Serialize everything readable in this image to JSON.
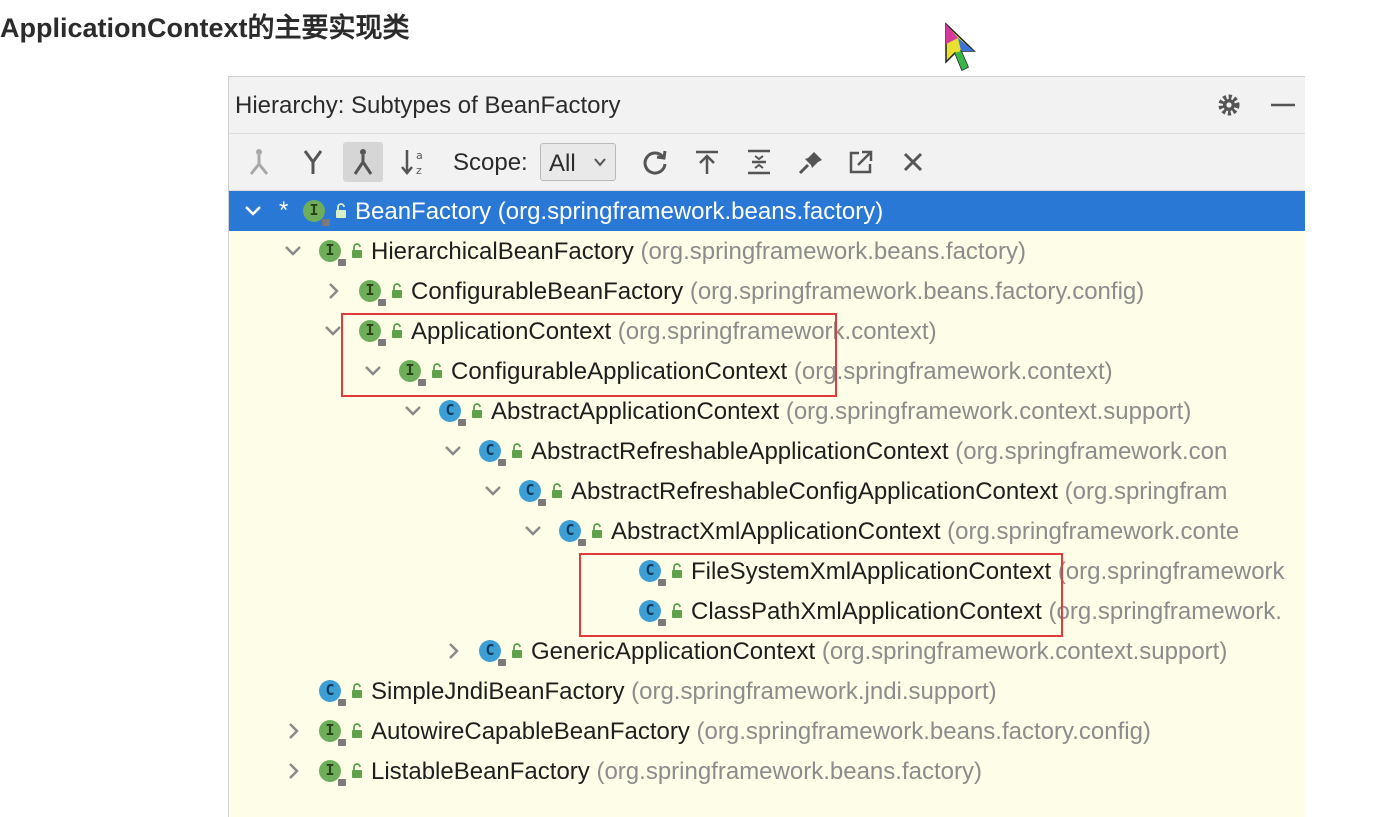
{
  "page": {
    "title": "ApplicationContext的主要实现类"
  },
  "panel": {
    "title": "Hierarchy:  Subtypes of BeanFactory",
    "header_icons": [
      "gear-icon",
      "minimize-icon"
    ]
  },
  "toolbar": {
    "buttons": [
      "supertypes-hierarchy-icon",
      "subtypes-hierarchy-icon",
      "class-hierarchy-icon",
      "sort-alphabetically-icon",
      "refresh-icon",
      "export-icon",
      "expand-all-icon",
      "pin-icon",
      "open-in-window-icon",
      "close-icon"
    ],
    "scope_label": "Scope:",
    "scope_value": "All"
  },
  "tree": {
    "rows": [
      {
        "name": "BeanFactory",
        "pkg": "(org.springframework.beans.factory)",
        "kind": "I",
        "arrow": "expanded",
        "selected": true,
        "star": "*"
      },
      {
        "name": "HierarchicalBeanFactory",
        "pkg": "(org.springframework.beans.factory)",
        "kind": "I",
        "arrow": "expanded"
      },
      {
        "name": "ConfigurableBeanFactory",
        "pkg": "(org.springframework.beans.factory.config)",
        "kind": "I",
        "arrow": "collapsed"
      },
      {
        "name": "ApplicationContext",
        "pkg": "(org.springframework.context)",
        "kind": "I",
        "arrow": "expanded"
      },
      {
        "name": "ConfigurableApplicationContext",
        "pkg": "(org.springframework.context)",
        "kind": "I",
        "arrow": "expanded"
      },
      {
        "name": "AbstractApplicationContext",
        "pkg": "(org.springframework.context.support)",
        "kind": "C",
        "arrow": "expanded"
      },
      {
        "name": "AbstractRefreshableApplicationContext",
        "pkg": "(org.springframework.con",
        "kind": "C",
        "arrow": "expanded"
      },
      {
        "name": "AbstractRefreshableConfigApplicationContext",
        "pkg": "(org.springfram",
        "kind": "C",
        "arrow": "expanded"
      },
      {
        "name": "AbstractXmlApplicationContext",
        "pkg": "(org.springframework.conte",
        "kind": "C",
        "arrow": "expanded"
      },
      {
        "name": "FileSystemXmlApplicationContext",
        "pkg": "(org.springframework",
        "kind": "C",
        "arrow": "none"
      },
      {
        "name": "ClassPathXmlApplicationContext",
        "pkg": "(org.springframework.",
        "kind": "C",
        "arrow": "none"
      },
      {
        "name": "GenericApplicationContext",
        "pkg": "(org.springframework.context.support)",
        "kind": "C",
        "arrow": "collapsed"
      },
      {
        "name": "SimpleJndiBeanFactory",
        "pkg": "(org.springframework.jndi.support)",
        "kind": "C",
        "arrow": "none"
      },
      {
        "name": "AutowireCapableBeanFactory",
        "pkg": "(org.springframework.beans.factory.config)",
        "kind": "I",
        "arrow": "collapsed"
      },
      {
        "name": "ListableBeanFactory",
        "pkg": "(org.springframework.beans.factory)",
        "kind": "I",
        "arrow": "collapsed"
      }
    ]
  },
  "colors": {
    "selection": "#2a78d6",
    "tree_background": "#fdfde8",
    "highlight_box": "#e23b3b",
    "interface_badge": "#6eae5a",
    "class_badge": "#3d9ed6"
  }
}
